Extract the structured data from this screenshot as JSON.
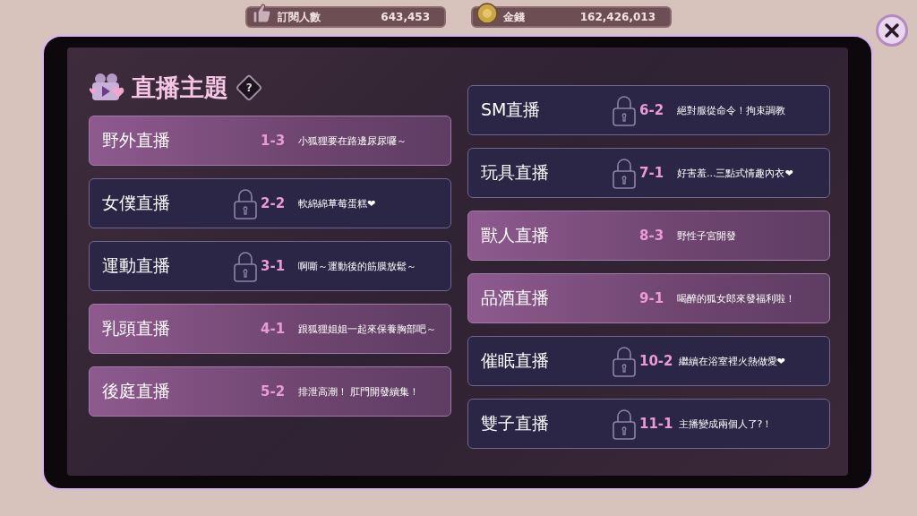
{
  "top_bar": {
    "stats": [
      {
        "kind": "subscribers",
        "label": "訂閱人數",
        "value": "643,453"
      },
      {
        "kind": "money",
        "label": "金錢",
        "value": "162,426,013"
      }
    ]
  },
  "dialog": {
    "title": "直播主題",
    "help": "?",
    "columns": [
      [
        {
          "name": "野外直播",
          "locked": false,
          "code": "1-3",
          "description": "小狐狸要在路邊尿尿囉～"
        },
        {
          "name": "女僕直播",
          "locked": true,
          "code": "2-2",
          "description": "軟綿綿草莓蛋糕❤"
        },
        {
          "name": "運動直播",
          "locked": true,
          "code": "3-1",
          "description": "啊嘶～運動後的筋膜放鬆～"
        },
        {
          "name": "乳頭直播",
          "locked": false,
          "code": "4-1",
          "description": "跟狐狸姐姐一起來保養胸部吧～"
        },
        {
          "name": "後庭直播",
          "locked": false,
          "code": "5-2",
          "description": "排泄高潮！ 肛門開發續集！"
        }
      ],
      [
        {
          "name": "SM直播",
          "locked": true,
          "code": "6-2",
          "description": "絕對服從命令！拘束調教"
        },
        {
          "name": "玩具直播",
          "locked": true,
          "code": "7-1",
          "description": "好害羞...三點式情趣內衣❤"
        },
        {
          "name": "獸人直播",
          "locked": false,
          "code": "8-3",
          "description": "野性子宮開發"
        },
        {
          "name": "品酒直播",
          "locked": false,
          "code": "9-1",
          "description": "喝醉的狐女郎來發福利啦！"
        },
        {
          "name": "催眠直播",
          "locked": true,
          "code": "10-2",
          "description": "繼續在浴室裡火熱做愛❤"
        },
        {
          "name": "雙子直播",
          "locked": true,
          "code": "11-1",
          "description": "主播變成兩個人了?！"
        }
      ]
    ]
  }
}
